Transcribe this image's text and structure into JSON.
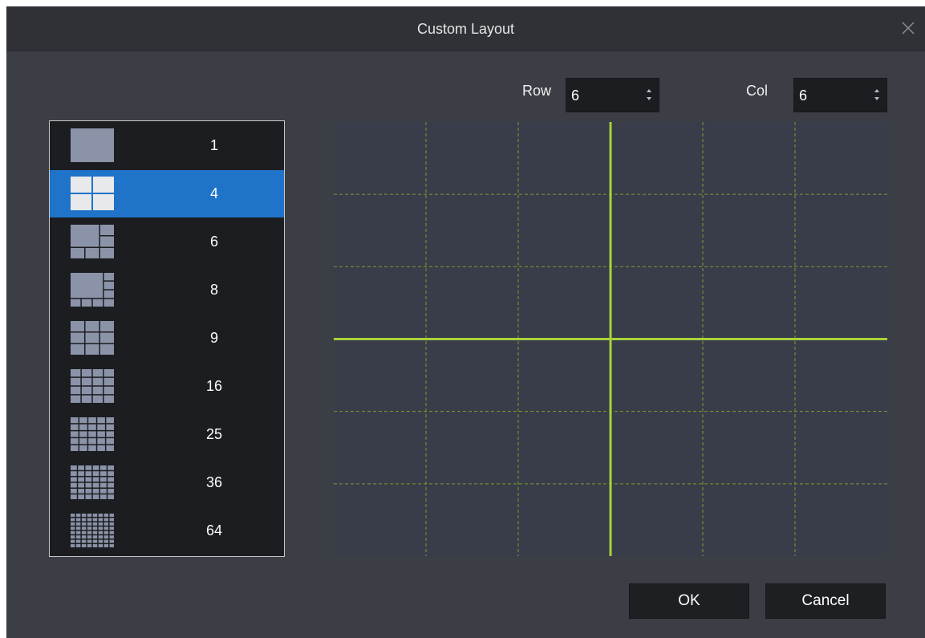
{
  "dialog": {
    "title": "Custom Layout",
    "close_icon": "close-icon"
  },
  "row": {
    "label": "Row",
    "value": "6"
  },
  "col": {
    "label": "Col",
    "value": "6"
  },
  "layouts": {
    "selected": "4",
    "items": [
      {
        "label": "1",
        "icon": "layout-1-icon"
      },
      {
        "label": "4",
        "icon": "layout-4-icon"
      },
      {
        "label": "6",
        "icon": "layout-6-icon"
      },
      {
        "label": "8",
        "icon": "layout-8-icon"
      },
      {
        "label": "9",
        "icon": "layout-9-icon"
      },
      {
        "label": "16",
        "icon": "layout-16-icon"
      },
      {
        "label": "25",
        "icon": "layout-25-icon"
      },
      {
        "label": "36",
        "icon": "layout-36-icon"
      },
      {
        "label": "64",
        "icon": "layout-64-icon"
      }
    ]
  },
  "grid": {
    "rows": 6,
    "cols": 6,
    "merged_split": {
      "row": 3,
      "col": 3
    }
  },
  "buttons": {
    "ok": "OK",
    "cancel": "Cancel"
  },
  "colors": {
    "accent": "#1f73c8",
    "grid_line": "#a8d13a",
    "grid_dash": "#7f9a2e"
  }
}
